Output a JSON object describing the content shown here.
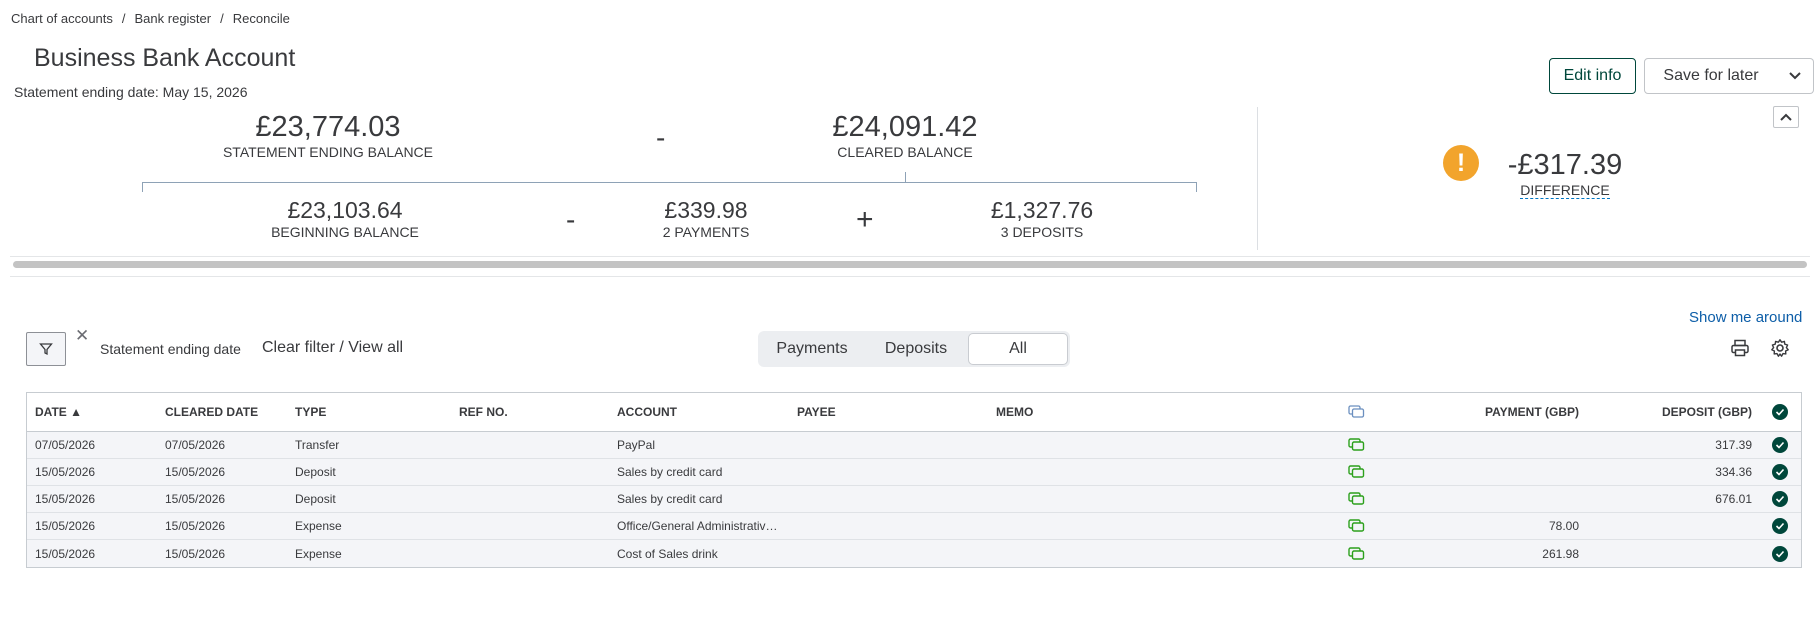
{
  "breadcrumb": [
    "Chart of accounts",
    "Bank register",
    "Reconcile"
  ],
  "breadcrumb_sep": "/",
  "title": "Business Bank Account",
  "statement_ending_date": "Statement ending date: May 15, 2026",
  "buttons": {
    "edit": "Edit info",
    "save": "Save for later"
  },
  "summary": {
    "statement_ending_balance": {
      "value": "£23,774.03",
      "label": "STATEMENT ENDING BALANCE"
    },
    "cleared_balance": {
      "value": "£24,091.42",
      "label": "CLEARED BALANCE"
    },
    "beginning_balance": {
      "value": "£23,103.64",
      "label": "BEGINNING BALANCE"
    },
    "payments": {
      "value": "£339.98",
      "label": "2 PAYMENTS"
    },
    "deposits": {
      "value": "£1,327.76",
      "label": "3 DEPOSITS"
    },
    "difference": {
      "value": "-£317.39",
      "label": "DIFFERENCE"
    },
    "op_minus": "-",
    "op_plus": "+",
    "warn_glyph": "!"
  },
  "show_me_around": "Show me around",
  "filter": {
    "chip": "Statement ending date",
    "clear": "Clear filter / View all",
    "close_glyph": "✕"
  },
  "tabs": [
    "Payments",
    "Deposits",
    "All"
  ],
  "table": {
    "headers": [
      "DATE ▲",
      "CLEARED DATE",
      "TYPE",
      "REF NO.",
      "ACCOUNT",
      "PAYEE",
      "MEMO",
      "PAYMENT (GBP)",
      "DEPOSIT (GBP)"
    ],
    "rows": [
      {
        "date": "07/05/2026",
        "cleared": "07/05/2026",
        "type": "Transfer",
        "ref": "",
        "account": "PayPal",
        "payee": "",
        "memo": "",
        "payment": "",
        "deposit": "317.39"
      },
      {
        "date": "15/05/2026",
        "cleared": "15/05/2026",
        "type": "Deposit",
        "ref": "",
        "account": "Sales by credit card",
        "payee": "",
        "memo": "",
        "payment": "",
        "deposit": "334.36"
      },
      {
        "date": "15/05/2026",
        "cleared": "15/05/2026",
        "type": "Deposit",
        "ref": "",
        "account": "Sales by credit card",
        "payee": "",
        "memo": "",
        "payment": "",
        "deposit": "676.01"
      },
      {
        "date": "15/05/2026",
        "cleared": "15/05/2026",
        "type": "Expense",
        "ref": "",
        "account": "Office/General Administrativ…",
        "payee": "",
        "memo": "",
        "payment": "78.00",
        "deposit": ""
      },
      {
        "date": "15/05/2026",
        "cleared": "15/05/2026",
        "type": "Expense",
        "ref": "",
        "account": "Cost of Sales drink",
        "payee": "",
        "memo": "",
        "payment": "261.98",
        "deposit": ""
      }
    ]
  },
  "colors": {
    "accent": "#00473b",
    "warning": "#f2a42c",
    "link": "#0d5ea8",
    "icon_green": "#2ca01c"
  }
}
